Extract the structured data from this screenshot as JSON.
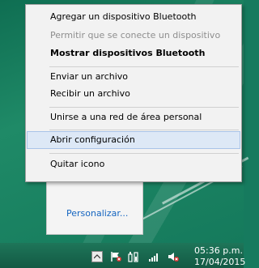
{
  "menu": {
    "items": [
      {
        "label": "Agregar un dispositivo Bluetooth",
        "state": "normal"
      },
      {
        "label": "Permitir que se conecte un dispositivo",
        "state": "disabled"
      },
      {
        "label": "Mostrar dispositivos Bluetooth",
        "state": "bold"
      },
      {
        "label": "Enviar un archivo",
        "state": "normal"
      },
      {
        "label": "Recibir un archivo",
        "state": "normal"
      },
      {
        "label": "Unirse a una red de área personal",
        "state": "normal"
      },
      {
        "label": "Abrir configuración",
        "state": "hover"
      },
      {
        "label": "Quitar icono",
        "state": "normal"
      }
    ]
  },
  "flyout": {
    "customize_label": "Personalizar..."
  },
  "taskbar": {
    "time": "05:36 p.m.",
    "date": "17/04/2015",
    "tray_icons": [
      "show-hidden-icons",
      "action-center-flag-icon",
      "power-icon",
      "network-signal-icon",
      "volume-muted-icon"
    ]
  },
  "colors": {
    "desktop": "#167a5e",
    "menu_bg": "#f2f2f2",
    "hover_bg": "#dde8f6",
    "link": "#1565c0"
  }
}
